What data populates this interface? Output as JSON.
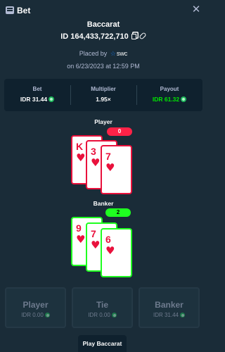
{
  "header": {
    "title": "Bet",
    "icon": "bet-slip-icon",
    "close_icon": "close-icon"
  },
  "bet": {
    "game": "Baccarat",
    "id_label": "ID",
    "id": "164,433,722,710",
    "placed_by_label": "Placed by",
    "user": "swc",
    "date": "on 6/23/2023 at 12:59 PM"
  },
  "stats": {
    "bet_label": "Bet",
    "bet_value": "IDR 31.44",
    "multiplier_label": "Multiplier",
    "multiplier_value": "1.95×",
    "payout_label": "Payout",
    "payout_value": "IDR 61.32"
  },
  "player_hand": {
    "label": "Player",
    "score": "0",
    "cards": [
      {
        "rank": "K",
        "suit": "♥"
      },
      {
        "rank": "3",
        "suit": "♥"
      },
      {
        "rank": "7",
        "suit": "♥"
      }
    ]
  },
  "banker_hand": {
    "label": "Banker",
    "score": "2",
    "cards": [
      {
        "rank": "9",
        "suit": "♥"
      },
      {
        "rank": "7",
        "suit": "♥"
      },
      {
        "rank": "6",
        "suit": "♥"
      }
    ]
  },
  "bet_options": [
    {
      "label": "Player",
      "amount": "IDR 0.00"
    },
    {
      "label": "Tie",
      "amount": "IDR 0.00"
    },
    {
      "label": "Banker",
      "amount": "IDR 31.44"
    }
  ],
  "play_button": "Play Baccarat",
  "colors": {
    "background": "#1a2c38",
    "panel": "#0f212e",
    "player_red": "#e9113c",
    "banker_green": "#1fff20",
    "payout_green": "#00e701",
    "muted_text": "#b1bad3"
  }
}
